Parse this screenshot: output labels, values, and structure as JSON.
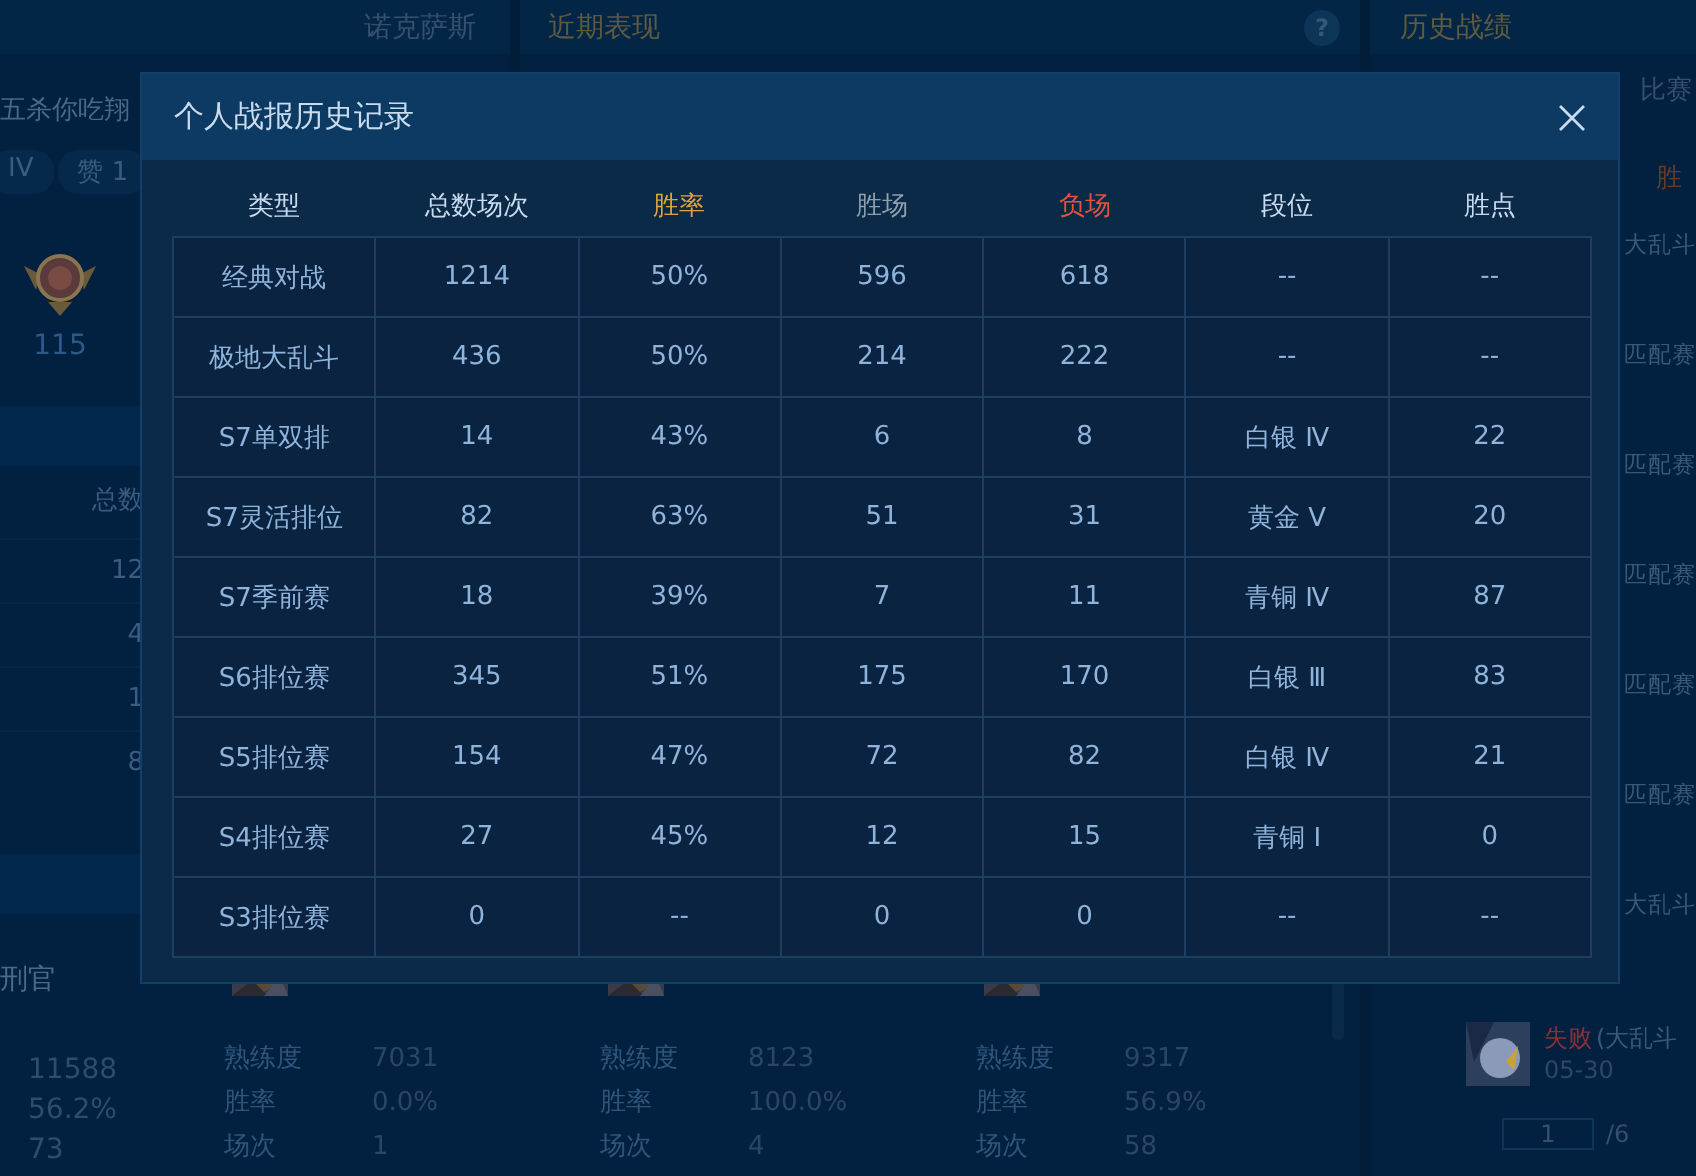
{
  "left_panel": {
    "region": "诺克萨斯",
    "player_name": "五杀你吃翔",
    "tags": [
      "IV",
      "赞 1"
    ],
    "badge_value": "115",
    "table_header": "总数",
    "table_values": [
      "12",
      "4",
      "1",
      "8"
    ],
    "hero_name": "刑官",
    "hero_stats": [
      "11588",
      "56.2%",
      "73"
    ]
  },
  "recent_panel": {
    "title": "近期表现",
    "help": "?",
    "hero_cards": [
      {
        "stats": [
          {
            "label": "熟练度",
            "value": "7031"
          },
          {
            "label": "胜率",
            "value": "0.0%"
          },
          {
            "label": "场次",
            "value": "1"
          }
        ]
      },
      {
        "stats": [
          {
            "label": "熟练度",
            "value": "8123"
          },
          {
            "label": "胜率",
            "value": "100.0%"
          },
          {
            "label": "场次",
            "value": "4"
          }
        ]
      },
      {
        "stats": [
          {
            "label": "熟练度",
            "value": "9317"
          },
          {
            "label": "胜率",
            "value": "56.9%"
          },
          {
            "label": "场次",
            "value": "58"
          }
        ]
      }
    ]
  },
  "history_panel": {
    "title": "历史战绩",
    "tab": "比赛",
    "column_header": "胜",
    "entries": [
      "大乱斗",
      "匹配赛",
      "匹配赛",
      "匹配赛",
      "匹配赛",
      "匹配赛",
      "大乱斗"
    ],
    "last_match": {
      "result": "失败",
      "mode": "(大乱斗",
      "date": "05-30"
    },
    "page": "1",
    "page_total": "/6"
  },
  "dialog": {
    "title": "个人战报历史记录",
    "columns": [
      {
        "label": "类型",
        "color": "#c9dbee"
      },
      {
        "label": "总数场次",
        "color": "#c9dbee"
      },
      {
        "label": "胜率",
        "color": "#e3a13f"
      },
      {
        "label": "胜场",
        "color": "#8e9fae"
      },
      {
        "label": "负场",
        "color": "#e2523e"
      },
      {
        "label": "段位",
        "color": "#c9dbee"
      },
      {
        "label": "胜点",
        "color": "#c9dbee"
      }
    ],
    "rows": [
      [
        "经典对战",
        "1214",
        "50%",
        "596",
        "618",
        "--",
        "--"
      ],
      [
        "极地大乱斗",
        "436",
        "50%",
        "214",
        "222",
        "--",
        "--"
      ],
      [
        "S7单双排",
        "14",
        "43%",
        "6",
        "8",
        "白银 Ⅳ",
        "22"
      ],
      [
        "S7灵活排位",
        "82",
        "63%",
        "51",
        "31",
        "黄金 Ⅴ",
        "20"
      ],
      [
        "S7季前赛",
        "18",
        "39%",
        "7",
        "11",
        "青铜 Ⅳ",
        "87"
      ],
      [
        "S6排位赛",
        "345",
        "51%",
        "175",
        "170",
        "白银 Ⅲ",
        "83"
      ],
      [
        "S5排位赛",
        "154",
        "47%",
        "72",
        "82",
        "白银 Ⅳ",
        "21"
      ],
      [
        "S4排位赛",
        "27",
        "45%",
        "12",
        "15",
        "青铜 Ⅰ",
        "0"
      ],
      [
        "S3排位赛",
        "0",
        "--",
        "0",
        "0",
        "--",
        "--"
      ]
    ]
  }
}
